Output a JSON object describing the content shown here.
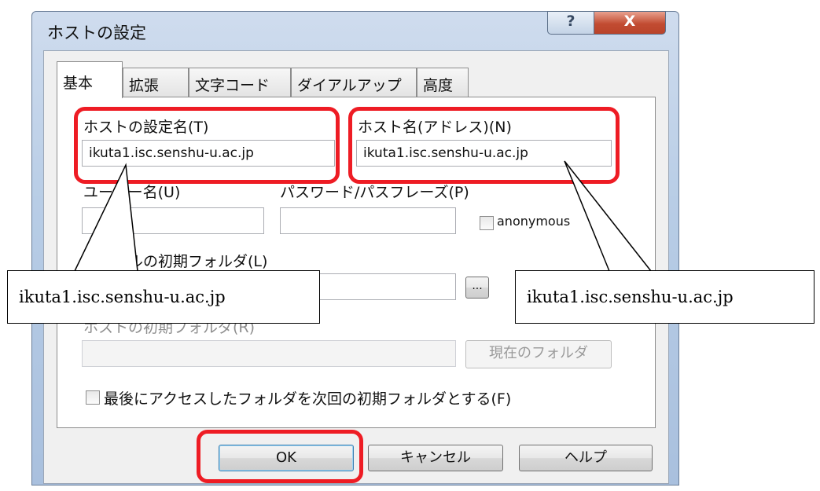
{
  "window": {
    "title": "ホストの設定",
    "help_label": "?",
    "close_label": "X"
  },
  "tabs": [
    "基本",
    "拡張",
    "文字コード",
    "ダイアルアップ",
    "高度"
  ],
  "form": {
    "host_setting_name_label": "ホストの設定名(T)",
    "host_setting_name_value": "ikuta1.isc.senshu-u.ac.jp",
    "host_name_label": "ホスト名(アドレス)(N)",
    "host_name_value": "ikuta1.isc.senshu-u.ac.jp",
    "user_name_label": "ユーザー名(U)",
    "password_label": "パスワード/パスフレーズ(P)",
    "anonymous_label": "anonymous",
    "local_folder_label": "ローカルの初期フォルダ(L)",
    "browse_label": "...",
    "host_folder_label": "ホストの初期フォルダ(R)",
    "current_folder_label": "現在のフォルダ",
    "last_access_label": "最後にアクセスしたフォルダを次回の初期フォルダとする(F)"
  },
  "buttons": {
    "ok": "OK",
    "cancel": "キャンセル",
    "help": "ヘルプ"
  },
  "callouts": {
    "left": "ikuta1.isc.senshu-u.ac.jp",
    "right": "ikuta1.isc.senshu-u.ac.jp"
  },
  "colors": {
    "highlight": "#ee1c24",
    "close_button": "#c24c32"
  }
}
